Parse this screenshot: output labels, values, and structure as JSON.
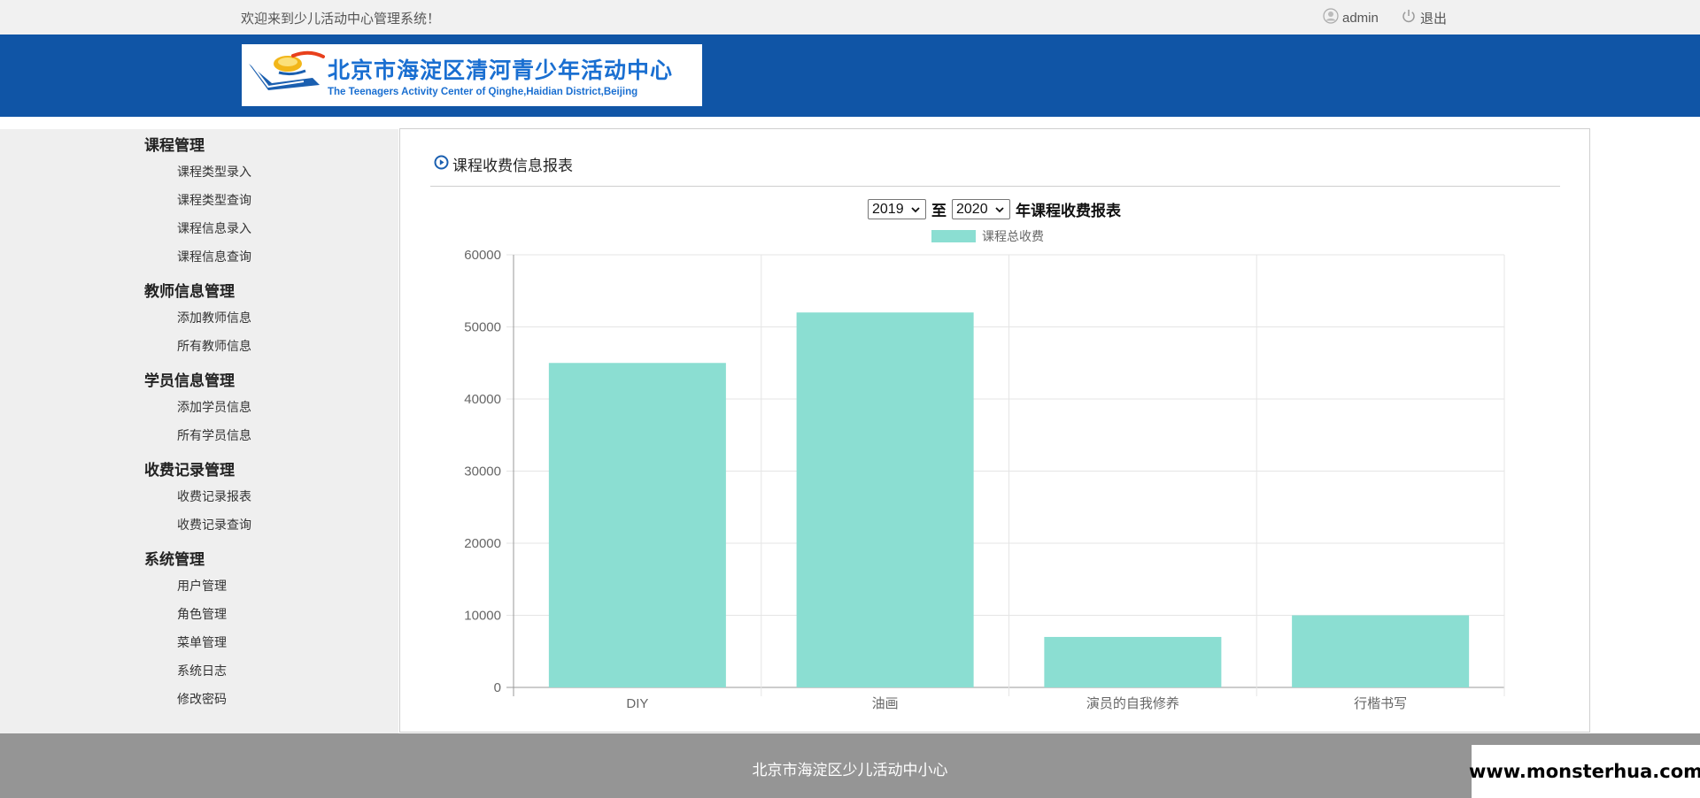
{
  "topbar": {
    "welcome": "欢迎来到少儿活动中心管理系统！",
    "user": "admin",
    "user_icon": "user-icon",
    "logout": "退出",
    "logout_icon": "power-icon"
  },
  "header": {
    "logo_cn": "北京市海淀区清河青少年活动中心",
    "logo_en": "The Teenagers Activity Center of Qinghe,Haidian District,Beijing"
  },
  "sidebar": {
    "groups": [
      {
        "title": "课程管理",
        "items": [
          "课程类型录入",
          "课程类型查询",
          "课程信息录入",
          "课程信息查询"
        ]
      },
      {
        "title": "教师信息管理",
        "items": [
          "添加教师信息",
          "所有教师信息"
        ]
      },
      {
        "title": "学员信息管理",
        "items": [
          "添加学员信息",
          "所有学员信息"
        ]
      },
      {
        "title": "收费记录管理",
        "items": [
          "收费记录报表",
          "收费记录查询"
        ]
      },
      {
        "title": "系统管理",
        "items": [
          "用户管理",
          "角色管理",
          "菜单管理",
          "系统日志",
          "修改密码"
        ]
      }
    ]
  },
  "panel": {
    "title": "课程收费信息报表",
    "title_icon": "play-circle-icon",
    "from_year": "2019",
    "to_sep": "至",
    "to_year": "2020",
    "chart_title": "年课程收费报表"
  },
  "chart_data": {
    "type": "bar",
    "categories": [
      "DIY",
      "油画",
      "演员的自我修养",
      "行楷书写"
    ],
    "series": [
      {
        "name": "课程总收费",
        "values": [
          45000,
          52000,
          7000,
          10000
        ]
      }
    ],
    "ylim": [
      0,
      60000
    ],
    "yticks": [
      0,
      10000,
      20000,
      30000,
      40000,
      50000,
      60000
    ],
    "grid": true,
    "legend": "top-center",
    "bar_color": "#8bded2",
    "axis_color": "#999999",
    "grid_color": "#e5e5e5"
  },
  "footer": {
    "text": "北京市海淀区少儿活动中小心"
  },
  "watermark": "www.monsterhua.com",
  "colors": {
    "header_blue": "#1055a6",
    "footer_gray": "#959595"
  }
}
